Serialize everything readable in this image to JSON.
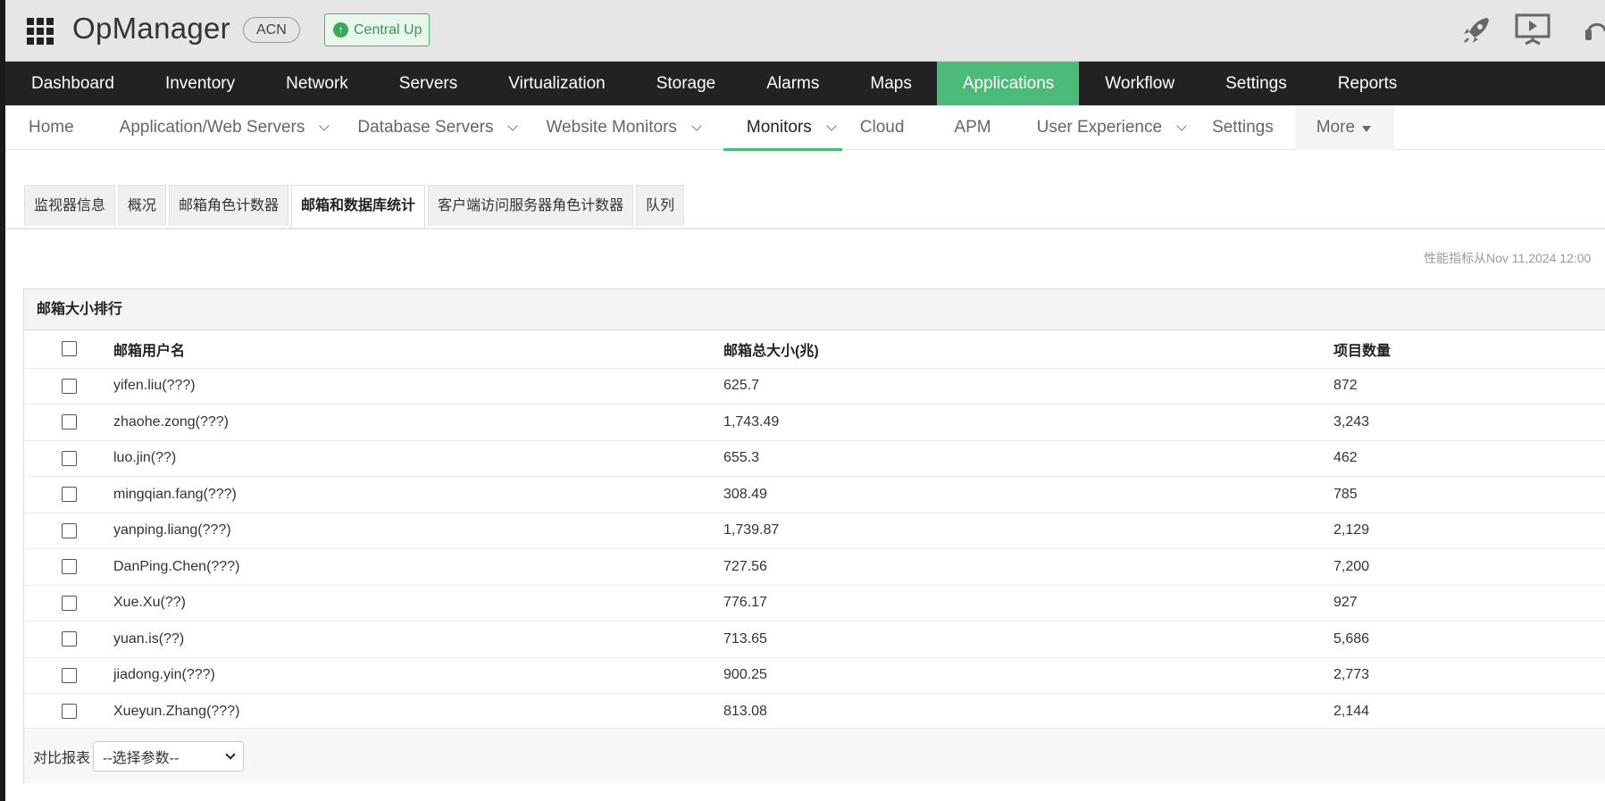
{
  "header": {
    "app_name": "OpManager",
    "tenant_badge": "ACN",
    "status_label": "Central Up",
    "icons": [
      "apps-grid-icon",
      "rocket-icon",
      "presentation-icon"
    ]
  },
  "main_nav": {
    "items": [
      "Dashboard",
      "Inventory",
      "Network",
      "Servers",
      "Virtualization",
      "Storage",
      "Alarms",
      "Maps",
      "Applications",
      "Workflow",
      "Settings",
      "Reports"
    ],
    "active": "Applications",
    "active_color": "#4cbb79"
  },
  "sub_nav": {
    "items": [
      {
        "label": "Home",
        "dropdown": false
      },
      {
        "label": "Application/Web Servers",
        "dropdown": true
      },
      {
        "label": "Database Servers",
        "dropdown": true
      },
      {
        "label": "Website Monitors",
        "dropdown": true
      },
      {
        "label": "Monitors",
        "dropdown": true
      },
      {
        "label": "Cloud",
        "dropdown": false
      },
      {
        "label": "APM",
        "dropdown": false
      },
      {
        "label": "User Experience",
        "dropdown": true
      },
      {
        "label": "Settings",
        "dropdown": false
      }
    ],
    "active": "Monitors",
    "more_label": "More"
  },
  "tabs": {
    "items": [
      "监视器信息",
      "概况",
      "邮箱角色计数器",
      "邮箱和数据库统计",
      "客户端访问服务器角色计数器",
      "队列"
    ],
    "active": "邮箱和数据库统计"
  },
  "perf_note": "性能指标从Nov 11,2024 12:00",
  "panel": {
    "title": "邮箱大小排行",
    "columns": [
      "邮箱用户名",
      "邮箱总大小(兆)",
      "项目数量"
    ],
    "rows": [
      {
        "user": "yifen.liu(???)",
        "size": "625.7",
        "items": "872"
      },
      {
        "user": "zhaohe.zong(???)",
        "size": "1,743.49",
        "items": "3,243"
      },
      {
        "user": "luo.jin(??)",
        "size": "655.3",
        "items": "462"
      },
      {
        "user": "mingqian.fang(???)",
        "size": "308.49",
        "items": "785"
      },
      {
        "user": "yanping.liang(???)",
        "size": "1,739.87",
        "items": "2,129"
      },
      {
        "user": "DanPing.Chen(???)",
        "size": "727.56",
        "items": "7,200"
      },
      {
        "user": "Xue.Xu(??)",
        "size": "776.17",
        "items": "927"
      },
      {
        "user": "yuan.is(??)",
        "size": "713.65",
        "items": "5,686"
      },
      {
        "user": "jiadong.yin(???)",
        "size": "900.25",
        "items": "2,773"
      },
      {
        "user": "Xueyun.Zhang(???)",
        "size": "813.08",
        "items": "2,144"
      }
    ],
    "compare_label": "对比报表",
    "compare_select_value": "--选择参数--"
  }
}
